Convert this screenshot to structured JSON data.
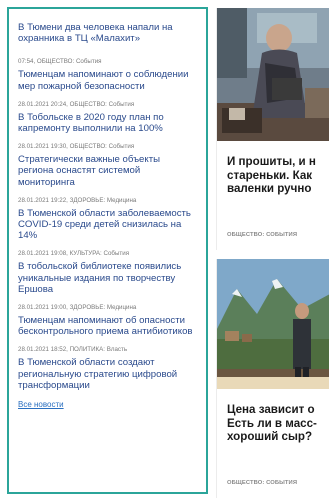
{
  "news_list": {
    "first_title": "В Тюмени два человека напали на охранника в ТЦ «Малахит»",
    "items": [
      {
        "meta": "07:54, ОБЩЕСТВО:",
        "category": "События",
        "title": "Тюменцам напоминают о соблюдении мер пожарной безопасности"
      },
      {
        "meta": "28.01.2021 20:24, ОБЩЕСТВО:",
        "category": "События",
        "title": "В Тобольске в 2020 году план по капремонту выполнили на 100%"
      },
      {
        "meta": "28.01.2021 19:30, ОБЩЕСТВО:",
        "category": "События",
        "title": "Стратегически важные объекты региона оснастят системой мониторинга"
      },
      {
        "meta": "28.01.2021 19:22, ЗДОРОВЬЕ:",
        "category": "Медицина",
        "title": "В Тюменской области заболеваемость COVID-19 среди детей снизилась на 14%"
      },
      {
        "meta": "28.01.2021 19:08, КУЛЬТУРА:",
        "category": "События",
        "title": "В тобольской библиотеке появились уникальные издания по творчеству Ершова"
      },
      {
        "meta": "28.01.2021 19:00, ЗДОРОВЬЕ:",
        "category": "Медицина",
        "title": "Тюменцам напоминают об опасности бесконтрольного приема антибиотиков"
      },
      {
        "meta": "28.01.2021 18:52, ПОЛИТИКА:",
        "category": "Власть",
        "title": "В Тюменской области создают региональную стратегию цифровой трансформации"
      }
    ],
    "all_news_label": "Все новости"
  },
  "cards": [
    {
      "title_lines": [
        "И прошиты, и н",
        "стареньки. Как",
        "валенки ручно"
      ],
      "rubric": "ОБЩЕСТВО: СОБЫТИЯ"
    },
    {
      "title_lines": [
        "Цена зависит о",
        "Есть ли в масс-",
        "хороший сыр?"
      ],
      "rubric": "ОБЩЕСТВО: СОБЫТИЯ"
    }
  ],
  "colors": {
    "accent_border": "#2ba59a",
    "link": "#2a4a8c"
  }
}
